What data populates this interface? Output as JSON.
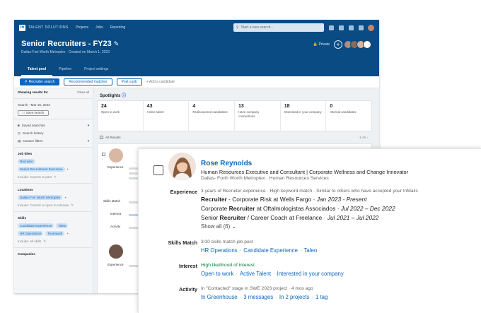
{
  "app": {
    "brand": "TALENT SOLUTIONS",
    "nav": [
      "Projects",
      "Jobs",
      "Reporting"
    ],
    "search_placeholder": "Start a new search...",
    "project_title": "Senior Recruiters - FY23",
    "project_subtitle": "Dallas-Fort Worth Metroplex · Created on March 1, 2023",
    "private_label": "Private",
    "tabs": [
      {
        "label": "Talent pool",
        "active": true
      },
      {
        "label": "Pipeline",
        "active": false
      },
      {
        "label": "Project settings",
        "active": false
      }
    ],
    "actions": {
      "recruiter_search": "Recruiter search",
      "recommended_matches": "Recommended matches",
      "post_job": "Post a job",
      "add_candidates": "+ Add a candidate"
    }
  },
  "sidebar": {
    "showing_results": "Showing results for",
    "clear_all": "Clear all",
    "search_date": "Search - Mar 16, 2023",
    "save_search": "Save search",
    "saved_searches": "Saved searches",
    "search_history": "Search history",
    "custom_filters": "Custom filters",
    "job_titles_label": "Job titles",
    "job_titles": [
      "Recruiter",
      "Senior Recruitment Executive"
    ],
    "exclude_current": "Include: Current or past",
    "locations_label": "Locations",
    "locations": [
      "Dallas-Fort Worth Metroplex"
    ],
    "locations_note": "Include: Current or open to relocate",
    "skills_label": "Skills",
    "skills": [
      "Candidate Experience",
      "Taleo",
      "HR Operations",
      "Teamwork"
    ],
    "skills_note": "Include: All skills",
    "companies_label": "Companies"
  },
  "spotlights": {
    "title": "Spotlights",
    "items": [
      {
        "value": "24",
        "label": "Open to work"
      },
      {
        "value": "43",
        "label": "Active talent"
      },
      {
        "value": "4",
        "label": "Rediscovered candidates"
      },
      {
        "value": "13",
        "label": "Have company connections"
      },
      {
        "value": "18",
        "label": "Interested in your company"
      },
      {
        "value": "0",
        "label": "Internal candidates"
      }
    ],
    "all_results": "All Results",
    "pager": "1-25"
  },
  "bg_card": {
    "experience": "Experience",
    "skills_match": "Skills Match",
    "interest": "Interest",
    "activity": "Activity"
  },
  "card": {
    "name": "Rose Reynolds",
    "headline": "Human Resources Executive and Consultant | Corporate Wellness and Change Innovator",
    "location": "Dallas- Forth Worth Metroplex · Human Resources Services",
    "experience_label": "Experience",
    "experience_meta": "3 years of Recruiter experience · High keyword match · Similar to others who have accepted your InMails",
    "experience_items": [
      {
        "keyword": "Recruiter",
        "rest": " - Corporate Risk at Wells Fargo · ",
        "dates": "Jan 2023 - Present",
        "bold_first": true
      },
      {
        "pre": "Corporate ",
        "keyword": "Recruiter",
        "rest": " at Oftalmologistas Associados · ",
        "dates": "Jul 2022 – Dec 2022",
        "bold_first": false
      },
      {
        "pre": "Senior ",
        "keyword": "Recruiter",
        "rest": " / Career Coach at Freelance · ",
        "dates": "Jul 2021 – Jul 2022",
        "bold_first": false
      }
    ],
    "show_all": "Show all (6)",
    "skills_label": "Skills Match",
    "skills_meta": "3/10 skills match job post",
    "skills": [
      "HR Operations",
      "Candidate Experience",
      "Taleo"
    ],
    "interest_label": "Interest",
    "interest_meta": "High likelihood of interest",
    "interest_links": [
      "Open to work",
      "Active Talent",
      "Interested in your company"
    ],
    "activity_label": "Activity",
    "activity_meta": "In \"Contacted\" stage in SWE 2023 project · 4 mos ago",
    "activity_links": [
      "In Greenhouse",
      "3 messages",
      "In 2 projects",
      "1 tag"
    ]
  }
}
